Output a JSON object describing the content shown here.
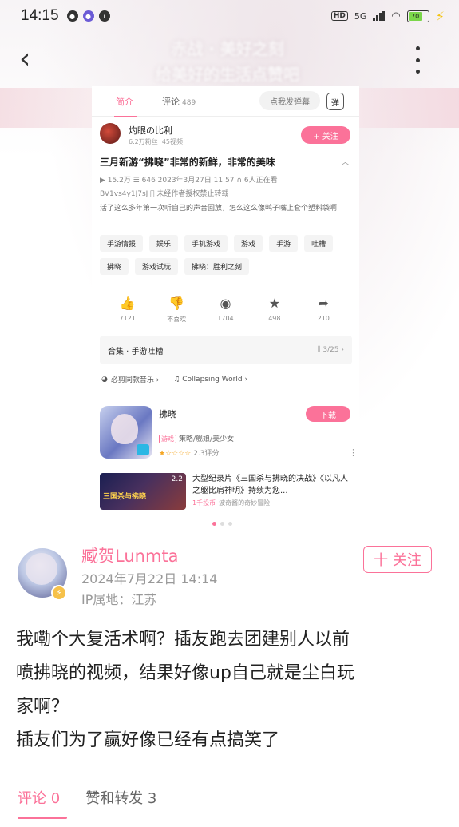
{
  "status_bar": {
    "time": "14:15",
    "network": "5G",
    "battery_level": "70"
  },
  "header": {
    "back_icon": "chevron-left-icon",
    "more_icon": "more-vertical-icon",
    "blurred_title": "赤战 · 美好之刻\n给美好的生活点赞吧"
  },
  "shared_screenshot": {
    "tabs": {
      "intro": "简介",
      "comments": "评论",
      "comments_count": "489"
    },
    "danmaku_placeholder": "点我发弹幕",
    "danmaku_icon_label": "弹",
    "uploader": {
      "name": "灼眼の比利",
      "fans": "6.2万粉丝",
      "videos": "45视频",
      "follow": "+ 关注"
    },
    "video": {
      "title": "三月新游“拂晓”非常的新鲜，非常的美味",
      "meta": "▶ 15.2万  ☰ 646  2023年3月27日 11:57  ∩ 6人正在看",
      "meta2": "BV1vs4y1J7sJ  ⃠ 未经作者授权禁止转载",
      "desc": "活了这么多年第一次听自己的声音回放，怎么这么像鸭子嘴上套个塑料袋啊"
    },
    "tags": [
      "手游情报",
      "娱乐",
      "手机游戏",
      "游戏",
      "手游",
      "吐槽",
      "拂晓",
      "游戏试玩",
      "拂晓：胜利之刻"
    ],
    "actions": [
      {
        "icon": "thumbs-up-icon",
        "glyph": "👍",
        "count": "7121"
      },
      {
        "icon": "thumbs-down-icon",
        "glyph": "👎",
        "count": "不喜欢"
      },
      {
        "icon": "coin-icon",
        "glyph": "◉",
        "count": "1704"
      },
      {
        "icon": "star-icon",
        "glyph": "★",
        "count": "498"
      },
      {
        "icon": "share-icon",
        "glyph": "➦",
        "count": "210"
      }
    ],
    "collection": {
      "label": "合集 · 手游吐槽",
      "index": "⫼ 3/25 ›"
    },
    "music": {
      "item1": "必剪同款音乐 ›",
      "item2": "♫ Collapsing World ›"
    },
    "game": {
      "name": "拂晓",
      "download": "下载",
      "category_badge": "游戏",
      "category": "策略/舰娘/美少女",
      "stars": "★☆☆☆☆",
      "rating": "2.3评分",
      "more": "⋮"
    },
    "recommend": {
      "thumb_text": "三国杀与拂晓",
      "thumb_num": "2.2",
      "title": "大型纪录片《三国杀与拂晓的决战》《以凡人之躯比肩神明》持续为您...",
      "badge": "1千投币",
      "sub": "波奇酱的奇妙冒险"
    }
  },
  "carousel": {
    "count": 3,
    "active": 0
  },
  "post": {
    "author": "臧贺Lunmta",
    "time": "2024年7月22日 14:14",
    "ip": "IP属地：江苏",
    "follow": "十 关注",
    "lines": [
      "我嘞个大复活术啊？插友跑去团建别人以前",
      "喷拂晓的视频，结果好像up自己就是尘白玩",
      "家啊？",
      "插友们为了赢好像已经有点搞笑了"
    ]
  },
  "bottom_tabs": {
    "comments": "评论 0",
    "likes": "赞和转发 3"
  },
  "colors": {
    "accent": "#fb7299"
  }
}
